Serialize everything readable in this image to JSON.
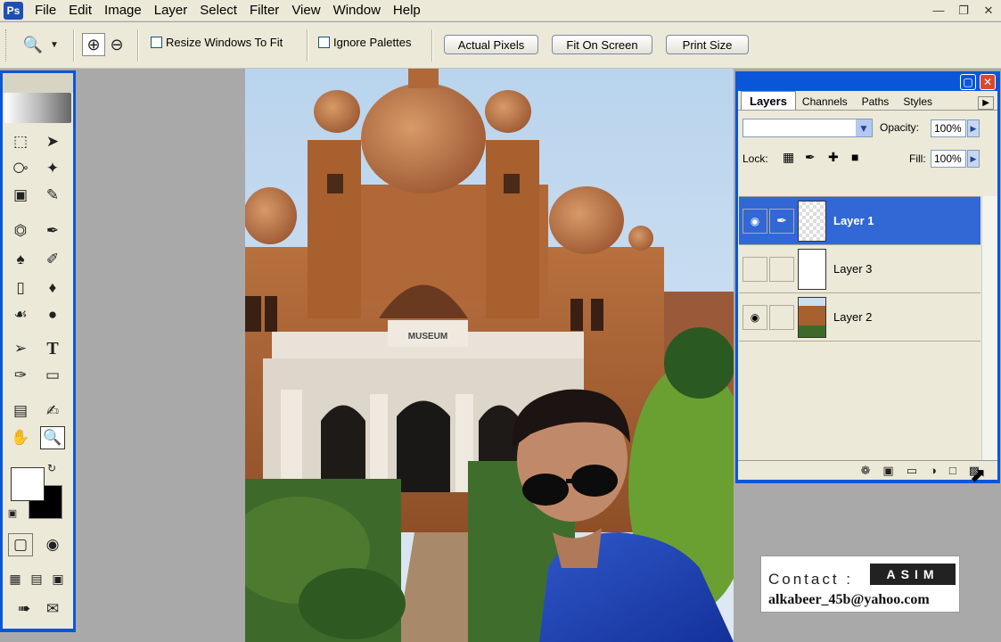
{
  "menu": [
    "File",
    "Edit",
    "Image",
    "Layer",
    "Select",
    "Filter",
    "View",
    "Window",
    "Help"
  ],
  "options_bar": {
    "resize_windows": "Resize Windows To Fit",
    "ignore_palettes": "Ignore Palettes",
    "actual_pixels": "Actual Pixels",
    "fit_on_screen": "Fit On Screen",
    "print_size": "Print Size"
  },
  "canvas": {
    "sign_text": "MUSEUM"
  },
  "layers_palette": {
    "tabs": [
      "Layers",
      "Channels",
      "Paths",
      "Styles"
    ],
    "opacity_label": "Opacity:",
    "opacity_value": "100%",
    "lock_label": "Lock:",
    "fill_label": "Fill:",
    "fill_value": "100%",
    "layers": [
      {
        "name": "Layer 1",
        "visible": true,
        "selected": true
      },
      {
        "name": "Layer 3",
        "visible": false,
        "selected": false
      },
      {
        "name": "Layer 2",
        "visible": true,
        "selected": false
      }
    ]
  },
  "contact": {
    "label": "Contact :",
    "badge": "ASIM",
    "email": "alkabeer_45b@yahoo.com"
  },
  "colors": {
    "xp_blue": "#0a56d8",
    "selection": "#3168d5",
    "panel": "#ece9d8"
  }
}
